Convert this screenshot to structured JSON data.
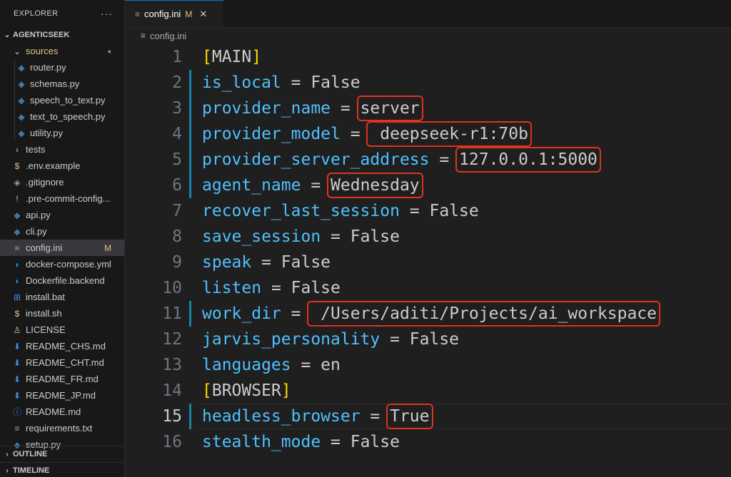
{
  "sidebar": {
    "title": "EXPLORER",
    "more": "···",
    "project": "AGENTICSEEK",
    "items": [
      {
        "label": "sources",
        "type": "folder-open",
        "indent": 1,
        "badge": "●"
      },
      {
        "label": "router.py",
        "type": "py",
        "indent": 2
      },
      {
        "label": "schemas.py",
        "type": "py",
        "indent": 2
      },
      {
        "label": "speech_to_text.py",
        "type": "py",
        "indent": 2
      },
      {
        "label": "text_to_speech.py",
        "type": "py",
        "indent": 2
      },
      {
        "label": "utility.py",
        "type": "py",
        "indent": 2
      },
      {
        "label": "tests",
        "type": "folder",
        "indent": 1
      },
      {
        "label": ".env.example",
        "type": "env",
        "indent": 1
      },
      {
        "label": ".gitignore",
        "type": "git",
        "indent": 1
      },
      {
        "label": ".pre-commit-config...",
        "type": "excl",
        "indent": 1
      },
      {
        "label": "api.py",
        "type": "py",
        "indent": 1
      },
      {
        "label": "cli.py",
        "type": "py",
        "indent": 1
      },
      {
        "label": "config.ini",
        "type": "ini",
        "indent": 1,
        "badge": "M",
        "active": true
      },
      {
        "label": "docker-compose.yml",
        "type": "docker",
        "indent": 1
      },
      {
        "label": "Dockerfile.backend",
        "type": "docker",
        "indent": 1
      },
      {
        "label": "install.bat",
        "type": "win",
        "indent": 1
      },
      {
        "label": "install.sh",
        "type": "env",
        "indent": 1
      },
      {
        "label": "LICENSE",
        "type": "license",
        "indent": 1
      },
      {
        "label": "README_CHS.md",
        "type": "md",
        "indent": 1
      },
      {
        "label": "README_CHT.md",
        "type": "md",
        "indent": 1
      },
      {
        "label": "README_FR.md",
        "type": "md",
        "indent": 1
      },
      {
        "label": "README_JP.md",
        "type": "md",
        "indent": 1
      },
      {
        "label": "README.md",
        "type": "info",
        "indent": 1
      },
      {
        "label": "requirements.txt",
        "type": "ini",
        "indent": 1
      },
      {
        "label": "setup.py",
        "type": "py",
        "indent": 1
      }
    ],
    "outline": "OUTLINE",
    "timeline": "TIMELINE"
  },
  "icons": {
    "py": "python-icon",
    "folder-open": "chevron-down-icon",
    "folder": "chevron-right-icon",
    "env": "dollar-icon",
    "git": "git-icon",
    "excl": "exclamation-icon",
    "ini": "settings-file-icon",
    "docker": "docker-icon",
    "win": "windows-icon",
    "license": "license-icon",
    "md": "markdown-icon",
    "info": "info-icon"
  },
  "colors": {
    "python": "#3c78aa",
    "env": "#e2c08d",
    "docker": "#1d91e6",
    "markdown": "#3b8eea",
    "key": "#4fc1ff",
    "bracket": "#ffd700",
    "highlight": "#e0321e",
    "modified": "#e2c08d"
  },
  "tab": {
    "label": "config.ini",
    "modified": "M",
    "close": "✕"
  },
  "breadcrumb": {
    "file": "config.ini"
  },
  "code": {
    "current_line": 15,
    "lines": [
      {
        "n": "1",
        "kind": "section",
        "text": "MAIN"
      },
      {
        "n": "2",
        "kind": "kv",
        "key": "is_local",
        "value": "False"
      },
      {
        "n": "3",
        "kind": "kv",
        "key": "provider_name",
        "value": "server",
        "highlight": true
      },
      {
        "n": "4",
        "kind": "kv",
        "key": "provider_model",
        "value": " deepseek-r1:70b",
        "highlight": true
      },
      {
        "n": "5",
        "kind": "kv",
        "key": "provider_server_address",
        "value": "127.0.0.1:5000",
        "highlight": true
      },
      {
        "n": "6",
        "kind": "kv",
        "key": "agent_name",
        "value": "Wednesday",
        "highlight": true
      },
      {
        "n": "7",
        "kind": "kv",
        "key": "recover_last_session",
        "value": "False"
      },
      {
        "n": "8",
        "kind": "kv",
        "key": "save_session",
        "value": "False"
      },
      {
        "n": "9",
        "kind": "kv",
        "key": "speak",
        "value": "False"
      },
      {
        "n": "10",
        "kind": "kv",
        "key": "listen",
        "value": "False"
      },
      {
        "n": "11",
        "kind": "kv",
        "key": "work_dir",
        "value": " /Users/aditi/Projects/ai_workspace",
        "highlight": true
      },
      {
        "n": "12",
        "kind": "kv",
        "key": "jarvis_personality",
        "value": "False"
      },
      {
        "n": "13",
        "kind": "kv",
        "key": "languages",
        "value": "en"
      },
      {
        "n": "14",
        "kind": "section",
        "text": "BROWSER"
      },
      {
        "n": "15",
        "kind": "kv",
        "key": "headless_browser",
        "value": "True",
        "highlight": true
      },
      {
        "n": "16",
        "kind": "kv",
        "key": "stealth_mode",
        "value": "False"
      }
    ]
  }
}
